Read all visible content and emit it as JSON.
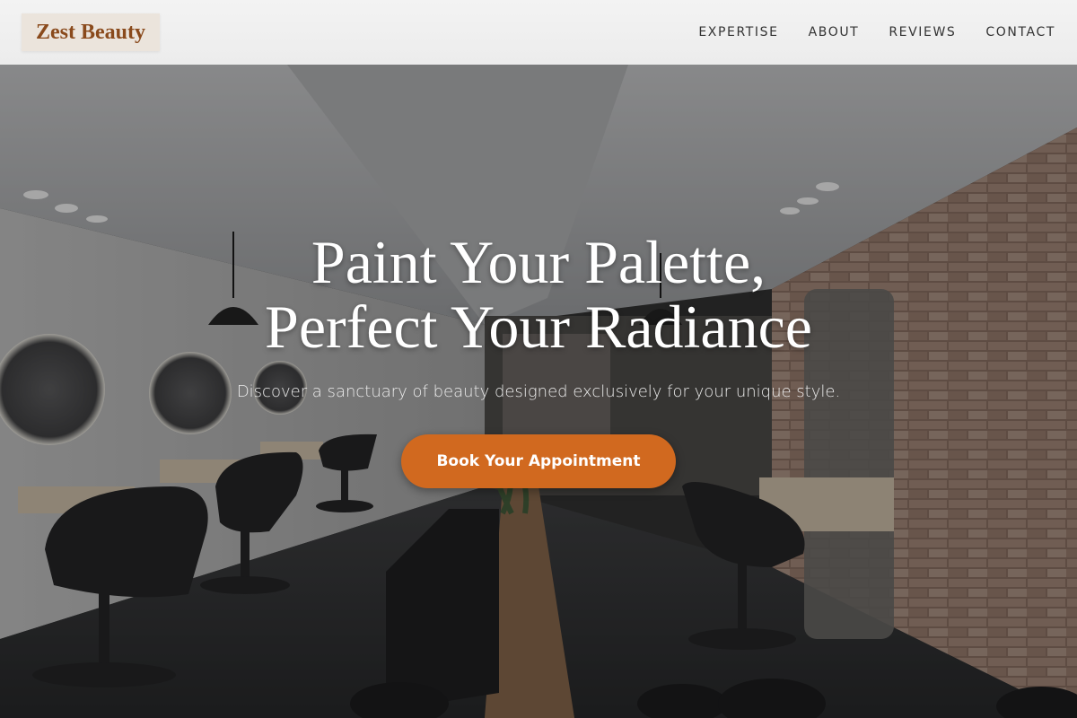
{
  "header": {
    "logo_text": "Zest Beauty",
    "nav": [
      {
        "label": "EXPERTISE"
      },
      {
        "label": "ABOUT"
      },
      {
        "label": "REVIEWS"
      },
      {
        "label": "CONTACT"
      }
    ]
  },
  "hero": {
    "headline_line1": "Paint Your Palette,",
    "headline_line2": "Perfect Your Radiance",
    "subtitle": "Discover a sanctuary of beauty designed exclusively for your unique style.",
    "cta_label": "Book Your Appointment",
    "background_image": "salon-interior-photo"
  },
  "colors": {
    "brand": "#8a4a1c",
    "accent": "#d1691f",
    "header_bg": "#efefef"
  }
}
